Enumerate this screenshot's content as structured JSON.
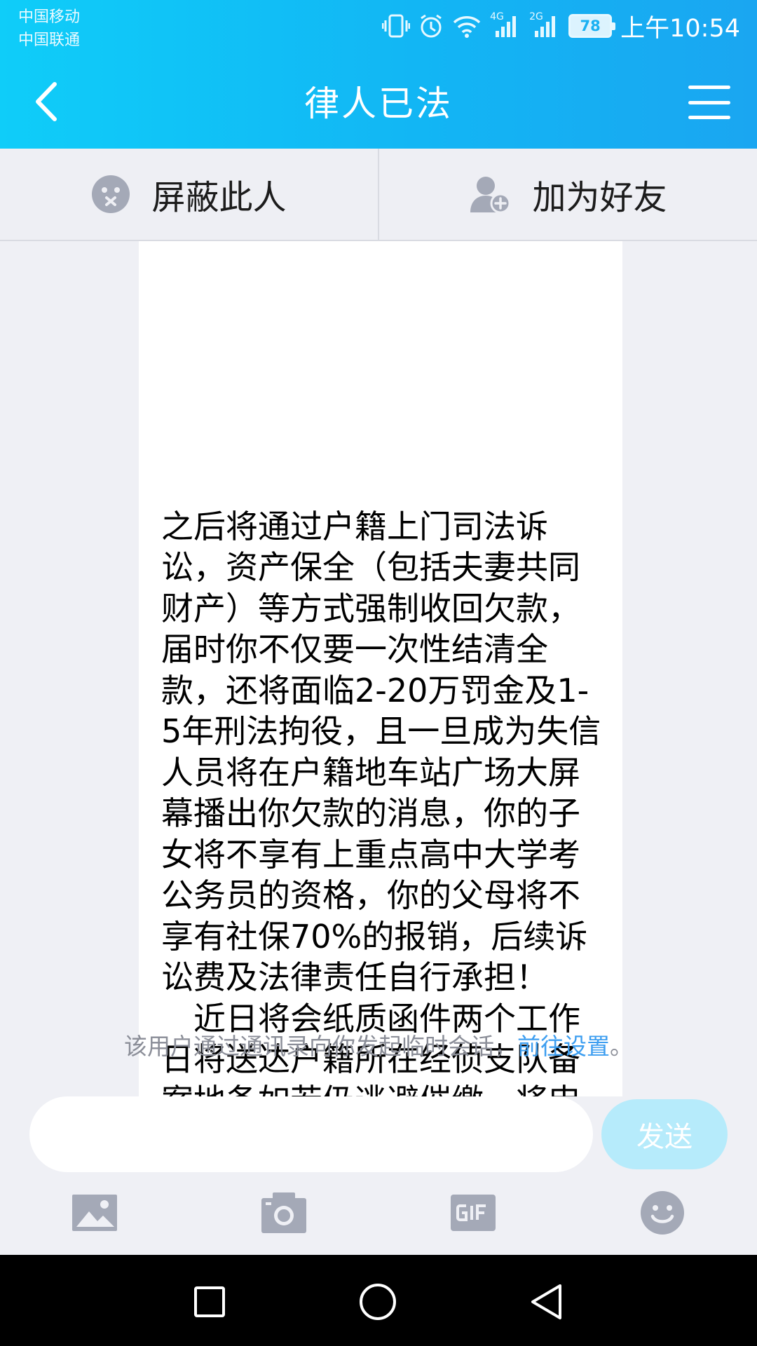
{
  "status_bar": {
    "carrier1": "中国移动",
    "carrier2": "中国联通",
    "net1": "4G",
    "net2": "2G",
    "battery": "78",
    "time": "上午10:54"
  },
  "nav": {
    "title": "律人已法"
  },
  "actions": {
    "block_label": "屏蔽此人",
    "add_friend_label": "加为好友"
  },
  "message": {
    "text": "之后将通过户籍上门司法诉讼，资产保全（包括夫妻共同财产）等方式强制收回欠款，届时你不仅要一次性结清全款，还将面临2-20万罚金及1-5年刑法拘役，且一旦成为失信人员将在户籍地车站广场大屏幕播出你欠款的消息，你的子女将不享有上重点高中大学考公务员的资格，你的父母将不享有社保70%的报销，后续诉讼费及法律责任自行承担！\n　近日将会纸质函件两个工作日将送达户籍所在经侦支队备案地备如若仍逃避催缴，将申请司法介入提起诉讼！特发此函警告!"
  },
  "notice": {
    "text": "该用户通过通讯录向你发起临时会话，",
    "link": "前往设置",
    "end": "。"
  },
  "input": {
    "value": "",
    "send_label": "发送"
  },
  "colors": {
    "header_start": "#0fcdf9",
    "header_end": "#1aa6f1",
    "link": "#3d9ef0",
    "send_disabled": "#b6ebfb",
    "tool_icon": "#a4a9b7"
  }
}
